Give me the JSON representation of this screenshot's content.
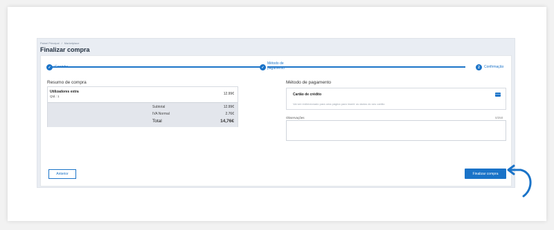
{
  "breadcrumb": {
    "home": "Painel Principal",
    "separator": "/",
    "current": "Marketplace"
  },
  "page": {
    "title": "Finalizar compra"
  },
  "stepper": {
    "steps": [
      {
        "label": "Carrinho",
        "state": "done"
      },
      {
        "label_line1": "Método de",
        "label_line2": "pagamento",
        "state": "done"
      },
      {
        "number": "2",
        "label": "Confirmação",
        "state": "current"
      }
    ]
  },
  "summary": {
    "title": "Resumo de compra",
    "item": {
      "name": "Utilizadores extra",
      "qty": "Qtd.: 1",
      "price": "12.99€"
    },
    "subtotal_label": "Subtotal",
    "subtotal_value": "12.99€",
    "tax_label": "IVA Normal",
    "tax_value": "2.76€",
    "total_label": "Total",
    "total_value": "14,76€"
  },
  "payment": {
    "title": "Método de pagamento",
    "option_title": "Cartão de crédito",
    "option_desc": "Vai ser redirecionado para uma página para inserir os dados do seu cartão",
    "icon": "credit-card-icon"
  },
  "notes": {
    "label": "Observações",
    "counter": "0/250",
    "value": ""
  },
  "buttons": {
    "back": "Anterior",
    "finish": "Finalizar compra"
  },
  "colors": {
    "accent": "#1a73c8",
    "background": "#e9edf3"
  }
}
